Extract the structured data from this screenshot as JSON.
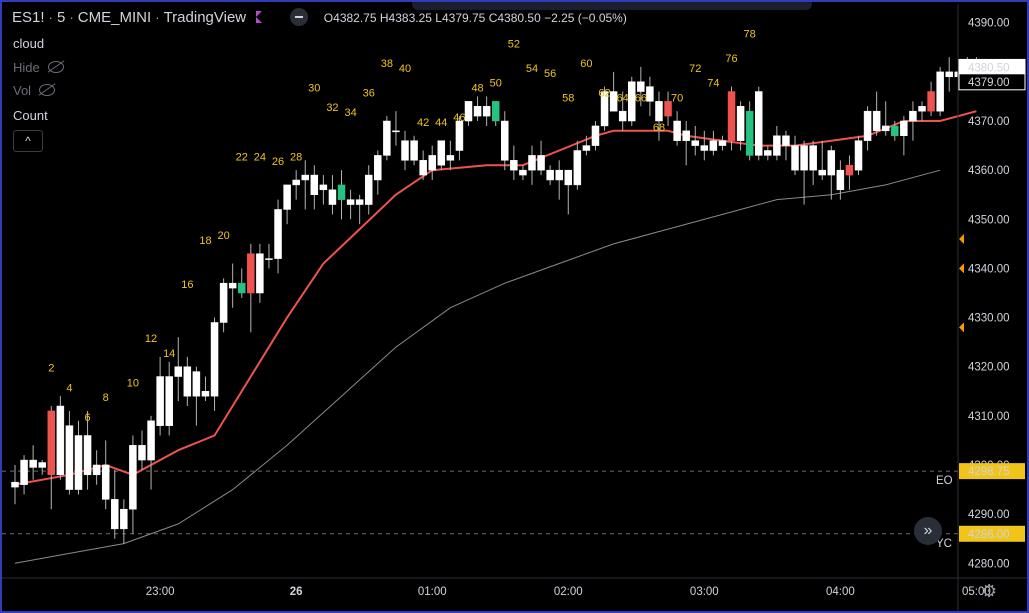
{
  "window": {
    "symbol": "ES1!",
    "interval": "5",
    "exchange": "CME_MINI",
    "source": "TradingView",
    "ohlc": {
      "open_label": "O",
      "open": "4382.75",
      "high_label": "H",
      "high": "4383.25",
      "low_label": "L",
      "low": "4379.75",
      "close_label": "C",
      "close": "4380.50",
      "change": "−2.25 (−0.05%)"
    }
  },
  "indicators": {
    "cloud": "cloud",
    "hide": "Hide",
    "vol": "Vol",
    "count": "Count",
    "collapse_glyph": "^"
  },
  "colors": {
    "bull": "#ffffff",
    "bear": "#ef5350",
    "signal": "#26c281",
    "ema_fast": "#ef5350",
    "ema_slow": "#8a8a8a",
    "count_label": "#f0c419",
    "background": "#000000",
    "frame": "#2f3dbd"
  },
  "price_tags": [
    {
      "label": "4380.50",
      "price": 4380.5,
      "style": "white"
    },
    {
      "label": "4379.00",
      "price": 4379.0,
      "style": "white"
    },
    {
      "label": "4298.75",
      "price": 4298.75,
      "style": "yellow",
      "line_label": "EO"
    },
    {
      "label": "4286.00",
      "price": 4286.0,
      "style": "yellow",
      "line_label": "YC"
    }
  ],
  "chart_data": {
    "type": "candlestick",
    "symbol": "ES1!",
    "interval_minutes": 5,
    "y_ticks": [
      "4280.00",
      "4290.00",
      "4300.00",
      "4310.00",
      "4320.00",
      "4330.00",
      "4340.00",
      "4350.00",
      "4360.00",
      "4370.00",
      "4380.00",
      "4390.00"
    ],
    "ylim": [
      4277,
      4393
    ],
    "x_ticks": [
      "23:00",
      "26",
      "01:00",
      "02:00",
      "03:00",
      "04:00",
      "05:00"
    ],
    "x_tick_index": [
      16,
      31,
      46,
      61,
      76,
      91,
      106
    ],
    "candles": [
      {
        "o": 4295.5,
        "h": 4300,
        "l": 4292,
        "c": 4296.5,
        "t": "bull"
      },
      {
        "o": 4296,
        "h": 4302,
        "l": 4294,
        "c": 4301,
        "t": "bull"
      },
      {
        "o": 4301,
        "h": 4304,
        "l": 4297,
        "c": 4299.5,
        "t": "bull"
      },
      {
        "o": 4299.5,
        "h": 4301,
        "l": 4298,
        "c": 4300.5,
        "t": "bull"
      },
      {
        "o": 4311,
        "h": 4312,
        "l": 4291,
        "c": 4298,
        "t": "bear"
      },
      {
        "o": 4298,
        "h": 4314,
        "l": 4297,
        "c": 4312,
        "t": "bull"
      },
      {
        "o": 4308,
        "h": 4311,
        "l": 4294,
        "c": 4295,
        "t": "bull"
      },
      {
        "o": 4295,
        "h": 4309,
        "l": 4294,
        "c": 4306,
        "t": "bull"
      },
      {
        "o": 4306,
        "h": 4311,
        "l": 4295,
        "c": 4298,
        "t": "bull"
      },
      {
        "o": 4298,
        "h": 4303,
        "l": 4296,
        "c": 4300,
        "t": "bull"
      },
      {
        "o": 4300,
        "h": 4305,
        "l": 4291,
        "c": 4293,
        "t": "bull"
      },
      {
        "o": 4293,
        "h": 4299,
        "l": 4285,
        "c": 4287,
        "t": "bull"
      },
      {
        "o": 4287,
        "h": 4293,
        "l": 4284,
        "c": 4291,
        "t": "bull"
      },
      {
        "o": 4291,
        "h": 4306,
        "l": 4286,
        "c": 4304,
        "t": "bull"
      },
      {
        "o": 4304,
        "h": 4307,
        "l": 4299,
        "c": 4301,
        "t": "bull"
      },
      {
        "o": 4301,
        "h": 4310,
        "l": 4295,
        "c": 4309,
        "t": "bull"
      },
      {
        "o": 4318,
        "h": 4322,
        "l": 4306,
        "c": 4308,
        "t": "bull"
      },
      {
        "o": 4308,
        "h": 4321,
        "l": 4306,
        "c": 4318,
        "t": "bull"
      },
      {
        "o": 4318,
        "h": 4326,
        "l": 4313,
        "c": 4320,
        "t": "bull"
      },
      {
        "o": 4320,
        "h": 4322,
        "l": 4312,
        "c": 4314,
        "t": "bull"
      },
      {
        "o": 4314,
        "h": 4320,
        "l": 4308,
        "c": 4319,
        "t": "bull"
      },
      {
        "o": 4315,
        "h": 4318,
        "l": 4313,
        "c": 4314,
        "t": "bull"
      },
      {
        "o": 4314,
        "h": 4330,
        "l": 4311,
        "c": 4329,
        "t": "bull"
      },
      {
        "o": 4329,
        "h": 4338,
        "l": 4327,
        "c": 4337,
        "t": "bull"
      },
      {
        "o": 4337,
        "h": 4341,
        "l": 4332,
        "c": 4336,
        "t": "bull"
      },
      {
        "o": 4337,
        "h": 4340,
        "l": 4334,
        "c": 4335,
        "t": "signal"
      },
      {
        "o": 4343,
        "h": 4345,
        "l": 4327,
        "c": 4335,
        "t": "bear"
      },
      {
        "o": 4335,
        "h": 4345,
        "l": 4333,
        "c": 4343,
        "t": "bull"
      },
      {
        "o": 4342,
        "h": 4345,
        "l": 4340,
        "c": 4342,
        "t": "bull"
      },
      {
        "o": 4342,
        "h": 4354,
        "l": 4339,
        "c": 4352,
        "t": "bull"
      },
      {
        "o": 4352,
        "h": 4357,
        "l": 4349,
        "c": 4357,
        "t": "bull"
      },
      {
        "o": 4357,
        "h": 4360,
        "l": 4354,
        "c": 4358,
        "t": "bull"
      },
      {
        "o": 4358,
        "h": 4362,
        "l": 4352,
        "c": 4359,
        "t": "bull"
      },
      {
        "o": 4359,
        "h": 4361,
        "l": 4352,
        "c": 4355,
        "t": "bull"
      },
      {
        "o": 4356,
        "h": 4359,
        "l": 4353,
        "c": 4357,
        "t": "bull"
      },
      {
        "o": 4356,
        "h": 4359,
        "l": 4351,
        "c": 4353,
        "t": "bull"
      },
      {
        "o": 4357,
        "h": 4360,
        "l": 4350,
        "c": 4354,
        "t": "signal"
      },
      {
        "o": 4354,
        "h": 4356,
        "l": 4350,
        "c": 4353,
        "t": "bull"
      },
      {
        "o": 4353,
        "h": 4355,
        "l": 4349,
        "c": 4354,
        "t": "bull"
      },
      {
        "o": 4353,
        "h": 4361,
        "l": 4351,
        "c": 4359,
        "t": "bull"
      },
      {
        "o": 4358,
        "h": 4364,
        "l": 4355,
        "c": 4363,
        "t": "bull"
      },
      {
        "o": 4363,
        "h": 4371,
        "l": 4362,
        "c": 4370,
        "t": "bull"
      },
      {
        "o": 4368,
        "h": 4372,
        "l": 4365,
        "c": 4368,
        "t": "bull"
      },
      {
        "o": 4366,
        "h": 4368,
        "l": 4360,
        "c": 4362,
        "t": "bull"
      },
      {
        "o": 4362,
        "h": 4367,
        "l": 4361,
        "c": 4366,
        "t": "bull"
      },
      {
        "o": 4362,
        "h": 4364,
        "l": 4358,
        "c": 4359,
        "t": "bull"
      },
      {
        "o": 4360,
        "h": 4365,
        "l": 4358,
        "c": 4363,
        "t": "bull"
      },
      {
        "o": 4361,
        "h": 4366,
        "l": 4360,
        "c": 4366,
        "t": "bull"
      },
      {
        "o": 4363,
        "h": 4366,
        "l": 4360,
        "c": 4362,
        "t": "bull"
      },
      {
        "o": 4364,
        "h": 4371,
        "l": 4362,
        "c": 4370,
        "t": "bull"
      },
      {
        "o": 4370,
        "h": 4374,
        "l": 4369,
        "c": 4374,
        "t": "bull"
      },
      {
        "o": 4373,
        "h": 4375,
        "l": 4370,
        "c": 4371,
        "t": "bull"
      },
      {
        "o": 4371,
        "h": 4375,
        "l": 4369,
        "c": 4373,
        "t": "bull"
      },
      {
        "o": 4374,
        "h": 4374,
        "l": 4369,
        "c": 4370,
        "t": "signal"
      },
      {
        "o": 4370,
        "h": 4372,
        "l": 4360,
        "c": 4362,
        "t": "bull"
      },
      {
        "o": 4362,
        "h": 4365,
        "l": 4358,
        "c": 4360,
        "t": "bull"
      },
      {
        "o": 4360,
        "h": 4361,
        "l": 4358,
        "c": 4359,
        "t": "bull"
      },
      {
        "o": 4360,
        "h": 4365,
        "l": 4357,
        "c": 4363,
        "t": "bull"
      },
      {
        "o": 4363,
        "h": 4366,
        "l": 4359,
        "c": 4360,
        "t": "bull"
      },
      {
        "o": 4360,
        "h": 4361,
        "l": 4357,
        "c": 4358,
        "t": "bull"
      },
      {
        "o": 4358,
        "h": 4362,
        "l": 4354,
        "c": 4360,
        "t": "bull"
      },
      {
        "o": 4360,
        "h": 4360,
        "l": 4351,
        "c": 4357,
        "t": "bull"
      },
      {
        "o": 4357,
        "h": 4366,
        "l": 4356,
        "c": 4364,
        "t": "bull"
      },
      {
        "o": 4364,
        "h": 4367,
        "l": 4363,
        "c": 4365,
        "t": "bull"
      },
      {
        "o": 4365,
        "h": 4370,
        "l": 4364,
        "c": 4369,
        "t": "bull"
      },
      {
        "o": 4369,
        "h": 4377,
        "l": 4368,
        "c": 4376,
        "t": "bull"
      },
      {
        "o": 4376,
        "h": 4380,
        "l": 4372,
        "c": 4372,
        "t": "bull"
      },
      {
        "o": 4372,
        "h": 4376,
        "l": 4368,
        "c": 4370,
        "t": "bull"
      },
      {
        "o": 4370,
        "h": 4379,
        "l": 4369,
        "c": 4378,
        "t": "bull"
      },
      {
        "o": 4378,
        "h": 4381,
        "l": 4373,
        "c": 4376,
        "t": "bull"
      },
      {
        "o": 4377,
        "h": 4379,
        "l": 4371,
        "c": 4374,
        "t": "bull"
      },
      {
        "o": 4374,
        "h": 4376,
        "l": 4366,
        "c": 4370,
        "t": "bull"
      },
      {
        "o": 4374,
        "h": 4376,
        "l": 4369,
        "c": 4371,
        "t": "bear"
      },
      {
        "o": 4370,
        "h": 4372,
        "l": 4365,
        "c": 4366,
        "t": "bull"
      },
      {
        "o": 4366,
        "h": 4370,
        "l": 4361,
        "c": 4368,
        "t": "bull"
      },
      {
        "o": 4366,
        "h": 4369,
        "l": 4363,
        "c": 4365,
        "t": "bull"
      },
      {
        "o": 4365,
        "h": 4368,
        "l": 4362,
        "c": 4364,
        "t": "bull"
      },
      {
        "o": 4364,
        "h": 4368,
        "l": 4363,
        "c": 4366,
        "t": "bull"
      },
      {
        "o": 4365,
        "h": 4367,
        "l": 4364,
        "c": 4366,
        "t": "bull"
      },
      {
        "o": 4376,
        "h": 4377,
        "l": 4364,
        "c": 4366,
        "t": "bear"
      },
      {
        "o": 4366,
        "h": 4374,
        "l": 4364,
        "c": 4373,
        "t": "bull"
      },
      {
        "o": 4372,
        "h": 4374,
        "l": 4362,
        "c": 4363,
        "t": "signal"
      },
      {
        "o": 4363,
        "h": 4377,
        "l": 4362,
        "c": 4376,
        "t": "bull"
      },
      {
        "o": 4364,
        "h": 4365,
        "l": 4362,
        "c": 4363,
        "t": "bull"
      },
      {
        "o": 4363,
        "h": 4369,
        "l": 4362,
        "c": 4367,
        "t": "bull"
      },
      {
        "o": 4367,
        "h": 4368,
        "l": 4362,
        "c": 4365,
        "t": "bull"
      },
      {
        "o": 4365,
        "h": 4367,
        "l": 4359,
        "c": 4360,
        "t": "bull"
      },
      {
        "o": 4360,
        "h": 4366,
        "l": 4353,
        "c": 4365,
        "t": "bull"
      },
      {
        "o": 4365,
        "h": 4366,
        "l": 4357,
        "c": 4360,
        "t": "bull"
      },
      {
        "o": 4360,
        "h": 4366,
        "l": 4358,
        "c": 4359,
        "t": "bull"
      },
      {
        "o": 4359,
        "h": 4365,
        "l": 4354,
        "c": 4364,
        "t": "bull"
      },
      {
        "o": 4360,
        "h": 4362,
        "l": 4354,
        "c": 4356,
        "t": "bull"
      },
      {
        "o": 4361,
        "h": 4363,
        "l": 4356,
        "c": 4359,
        "t": "bear"
      },
      {
        "o": 4360,
        "h": 4367,
        "l": 4359,
        "c": 4366,
        "t": "bull"
      },
      {
        "o": 4366,
        "h": 4373,
        "l": 4364,
        "c": 4372,
        "t": "bull"
      },
      {
        "o": 4372,
        "h": 4376,
        "l": 4367,
        "c": 4368,
        "t": "bull"
      },
      {
        "o": 4368,
        "h": 4374,
        "l": 4367,
        "c": 4369,
        "t": "bull"
      },
      {
        "o": 4369,
        "h": 4370,
        "l": 4366,
        "c": 4367,
        "t": "signal"
      },
      {
        "o": 4367,
        "h": 4371,
        "l": 4363,
        "c": 4370,
        "t": "bull"
      },
      {
        "o": 4370,
        "h": 4374,
        "l": 4366,
        "c": 4372,
        "t": "bull"
      },
      {
        "o": 4372,
        "h": 4374,
        "l": 4370,
        "c": 4373,
        "t": "bull"
      },
      {
        "o": 4376,
        "h": 4378,
        "l": 4371,
        "c": 4372,
        "t": "bear"
      },
      {
        "o": 4372,
        "h": 4381,
        "l": 4371,
        "c": 4380,
        "t": "bull"
      },
      {
        "o": 4380,
        "h": 4383,
        "l": 4376,
        "c": 4379,
        "t": "bull"
      },
      {
        "o": 4379,
        "h": 4382,
        "l": 4378,
        "c": 4380,
        "t": "bull"
      },
      {
        "o": 4380,
        "h": 4383,
        "l": 4379,
        "c": 4381,
        "t": "bull"
      },
      {
        "o": 4380,
        "h": 4383,
        "l": 4380,
        "c": 4381,
        "t": "bull"
      }
    ],
    "count_labels": [
      {
        "text": "2",
        "i": 4,
        "p": 4319
      },
      {
        "text": "4",
        "i": 6,
        "p": 4315
      },
      {
        "text": "6",
        "i": 8,
        "p": 4309
      },
      {
        "text": "8",
        "i": 10,
        "p": 4313
      },
      {
        "text": "10",
        "i": 13,
        "p": 4316
      },
      {
        "text": "12",
        "i": 15,
        "p": 4325
      },
      {
        "text": "14",
        "i": 17,
        "p": 4322
      },
      {
        "text": "16",
        "i": 19,
        "p": 4336
      },
      {
        "text": "18",
        "i": 21,
        "p": 4345
      },
      {
        "text": "20",
        "i": 23,
        "p": 4346
      },
      {
        "text": "22",
        "i": 25,
        "p": 4362
      },
      {
        "text": "24",
        "i": 27,
        "p": 4362
      },
      {
        "text": "26",
        "i": 29,
        "p": 4361
      },
      {
        "text": "28",
        "i": 31,
        "p": 4362
      },
      {
        "text": "30",
        "i": 33,
        "p": 4376
      },
      {
        "text": "32",
        "i": 35,
        "p": 4372
      },
      {
        "text": "34",
        "i": 37,
        "p": 4371
      },
      {
        "text": "36",
        "i": 39,
        "p": 4375
      },
      {
        "text": "38",
        "i": 41,
        "p": 4381
      },
      {
        "text": "40",
        "i": 43,
        "p": 4380
      },
      {
        "text": "42",
        "i": 45,
        "p": 4369
      },
      {
        "text": "44",
        "i": 47,
        "p": 4369
      },
      {
        "text": "46",
        "i": 49,
        "p": 4370
      },
      {
        "text": "48",
        "i": 51,
        "p": 4376
      },
      {
        "text": "50",
        "i": 53,
        "p": 4377
      },
      {
        "text": "52",
        "i": 55,
        "p": 4385
      },
      {
        "text": "54",
        "i": 57,
        "p": 4380
      },
      {
        "text": "56",
        "i": 59,
        "p": 4379
      },
      {
        "text": "58",
        "i": 61,
        "p": 4374
      },
      {
        "text": "60",
        "i": 63,
        "p": 4381
      },
      {
        "text": "62",
        "i": 65,
        "p": 4375
      },
      {
        "text": "64",
        "i": 67,
        "p": 4374
      },
      {
        "text": "66",
        "i": 69,
        "p": 4374
      },
      {
        "text": "68",
        "i": 71,
        "p": 4368
      },
      {
        "text": "70",
        "i": 73,
        "p": 4374
      },
      {
        "text": "72",
        "i": 75,
        "p": 4380
      },
      {
        "text": "74",
        "i": 77,
        "p": 4377
      },
      {
        "text": "76",
        "i": 79,
        "p": 4382
      },
      {
        "text": "78",
        "i": 81,
        "p": 4387
      }
    ],
    "series": [
      {
        "name": "",
        "color": "#ef5350",
        "points": [
          [
            0,
            4296
          ],
          [
            6,
            4298
          ],
          [
            10,
            4300
          ],
          [
            13,
            4298
          ],
          [
            18,
            4303
          ],
          [
            22,
            4306
          ],
          [
            26,
            4318
          ],
          [
            30,
            4330
          ],
          [
            34,
            4341
          ],
          [
            38,
            4348
          ],
          [
            42,
            4355
          ],
          [
            46,
            4360
          ],
          [
            52,
            4361
          ],
          [
            56,
            4361
          ],
          [
            60,
            4364
          ],
          [
            64,
            4367
          ],
          [
            66,
            4368
          ],
          [
            72,
            4368
          ],
          [
            74,
            4367
          ],
          [
            78,
            4366
          ],
          [
            82,
            4365
          ],
          [
            86,
            4365
          ],
          [
            90,
            4366
          ],
          [
            94,
            4367
          ],
          [
            98,
            4370
          ],
          [
            102,
            4370
          ],
          [
            106,
            4372
          ]
        ]
      },
      {
        "name": "",
        "color": "#8a8a8a",
        "points": [
          [
            0,
            4280
          ],
          [
            6,
            4282
          ],
          [
            12,
            4284
          ],
          [
            18,
            4288
          ],
          [
            24,
            4295
          ],
          [
            30,
            4304
          ],
          [
            36,
            4314
          ],
          [
            42,
            4324
          ],
          [
            48,
            4332
          ],
          [
            54,
            4337
          ],
          [
            60,
            4341
          ],
          [
            66,
            4345
          ],
          [
            72,
            4348
          ],
          [
            78,
            4351
          ],
          [
            84,
            4354
          ],
          [
            90,
            4355
          ],
          [
            96,
            4357
          ],
          [
            102,
            4360
          ]
        ]
      }
    ]
  },
  "axis": {
    "x_ticks_bold": [
      "26"
    ]
  },
  "controls": {
    "fast_forward": "»",
    "gear": "⚙"
  }
}
